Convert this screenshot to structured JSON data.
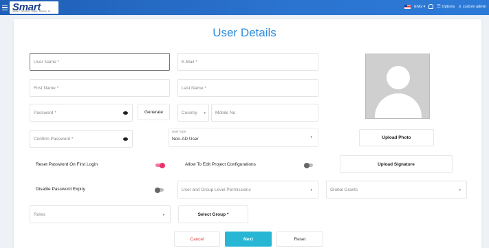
{
  "header": {
    "logo_text": "Smart",
    "logo_tagline": "Solutions · Technology · Strategy · Reporting · Inc.",
    "language": "ENG",
    "language_caret": "▾",
    "options_label": "Options",
    "user_label": "custom admin"
  },
  "page": {
    "title": "User Details"
  },
  "form": {
    "username_placeholder": "User Name *",
    "email_placeholder": "E-Mail *",
    "firstname_placeholder": "First Name *",
    "lastname_placeholder": "Last Name *",
    "password_placeholder": "Password *",
    "generate_label": "Generate",
    "country_placeholder": "Country",
    "country_caret": "▾",
    "mobile_placeholder": "Mobile No",
    "confirm_password_placeholder": "Confirm Password *",
    "user_type_label": "User Type",
    "user_type_value": "Non-AD User",
    "reset_password_label": "Reset Password On First Login",
    "reset_password_on": true,
    "edit_project_label": "Allow To Edit Project Configurations",
    "edit_project_on": false,
    "disable_expiry_label": "Disable Password Expiry",
    "disable_expiry_on": false,
    "permissions_placeholder": "User and Group Level Permissions",
    "global_grants_placeholder": "Global Grants",
    "roles_placeholder": "Roles",
    "select_group_label": "Select Group *",
    "dropdown_caret": "▾"
  },
  "side": {
    "upload_photo_label": "Upload Photo",
    "upload_signature_label": "Upload Signature"
  },
  "footer": {
    "cancel_label": "Cancel",
    "next_label": "Next",
    "reset_label": "Reset"
  },
  "colors": {
    "header_blue": "#2b74cf",
    "title_blue": "#2e8ddb",
    "next_button": "#27b7d4",
    "cancel_text": "#e53935",
    "toggle_on": "#e8336b"
  }
}
